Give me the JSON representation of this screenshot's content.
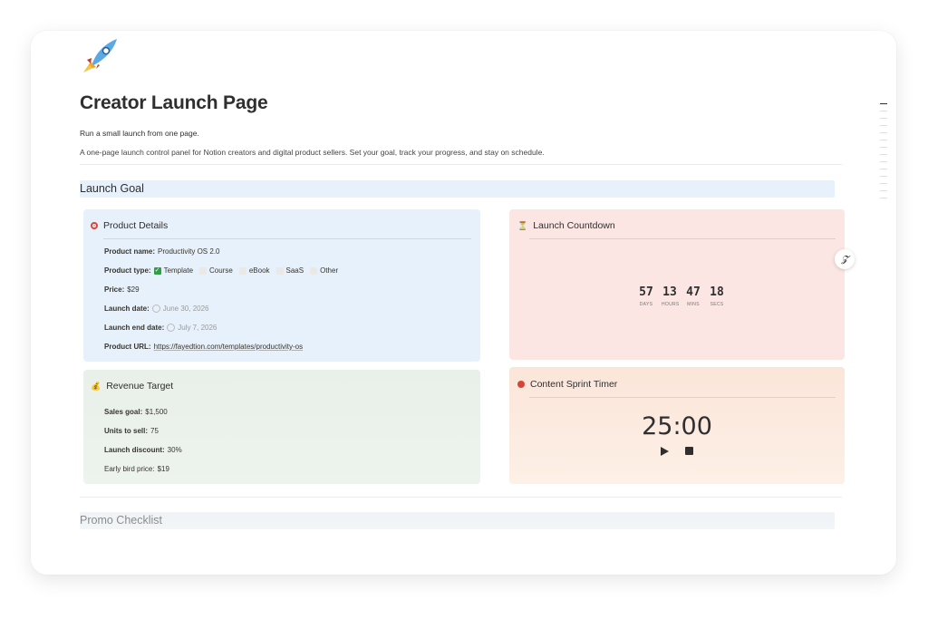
{
  "page": {
    "title": "Creator Launch Page",
    "subtitle": "Run a small launch from one page.",
    "description": "A one-page launch control panel for Notion creators and digital product sellers. Set your goal, track your progress, and stay on schedule."
  },
  "sections": {
    "launch_goal": "Launch Goal",
    "promo_checklist": "Promo Checklist"
  },
  "product_details": {
    "title": "Product Details",
    "icon": "target-icon",
    "name_label": "Product name:",
    "name_value": "Productivity OS 2.0",
    "type_label": "Product type:",
    "types": [
      {
        "label": "Template",
        "checked": true
      },
      {
        "label": "Course",
        "checked": false
      },
      {
        "label": "eBook",
        "checked": false
      },
      {
        "label": "SaaS",
        "checked": false
      },
      {
        "label": "Other",
        "checked": false
      }
    ],
    "price_label": "Price:",
    "price_value": "$29",
    "launch_date_label": "Launch date:",
    "launch_date_value": "June 30, 2026",
    "launch_end_label": "Launch end date:",
    "launch_end_value": "July 7, 2026",
    "url_label": "Product URL:",
    "url_value": "https://fayedtion.com/templates/productivity-os",
    "color": "#e7f1fb"
  },
  "revenue_target": {
    "title": "Revenue Target",
    "icon": "money-bag-icon",
    "sales_goal_label": "Sales goal:",
    "sales_goal_value": "$1,500",
    "units_label": "Units to sell:",
    "units_value": "75",
    "discount_label": "Launch discount:",
    "discount_value": "30%",
    "early_bird_label": "Early bird price:",
    "early_bird_value": "$19",
    "color": "#e9f0e9"
  },
  "launch_countdown": {
    "title": "Launch Countdown",
    "icon": "hourglass-icon",
    "units": [
      {
        "value": "57",
        "label": "DAYS"
      },
      {
        "value": "13",
        "label": "HOURS"
      },
      {
        "value": "47",
        "label": "MINS"
      },
      {
        "value": "18",
        "label": "SECS"
      }
    ],
    "color": "#fbe6e3"
  },
  "content_sprint_timer": {
    "title": "Content Sprint Timer",
    "icon": "red-circle-icon",
    "display": "25:00",
    "color": "#fbe8dc"
  }
}
